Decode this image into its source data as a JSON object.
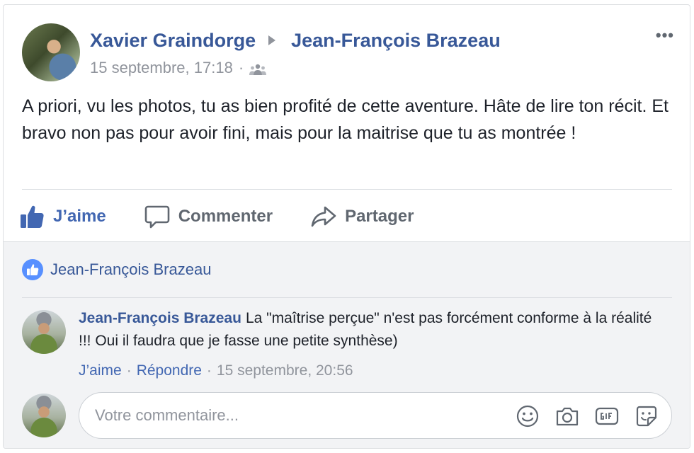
{
  "post": {
    "author": "Xavier Graindorge",
    "recipient": "Jean-François Brazeau",
    "timestamp": "15 septembre, 17:18",
    "meta_separator": "·",
    "audience_icon": "group-icon",
    "more_label": "•••",
    "text": "A priori, vu les photos, tu as bien profité de cette aventure. Hâte de lire ton récit. Et bravo non pas pour avoir fini, mais pour la maitrise que tu as montrée !"
  },
  "actions": {
    "like_label": "J’aime",
    "comment_label": "Commenter",
    "share_label": "Partager"
  },
  "reactions": {
    "liker": "Jean-François Brazeau"
  },
  "comment": {
    "author": "Jean-François Brazeau",
    "text": "La \"maîtrise perçue\" n'est pas forcément conforme à la réalité !!! Oui il faudra que je fasse une petite synthèse)",
    "like_label": "J’aime",
    "reply_label": "Répondre",
    "separator": "·",
    "timestamp": "15 septembre, 20:56"
  },
  "reply_box": {
    "placeholder": "Votre commentaire..."
  },
  "colors": {
    "brand_link": "#385898",
    "action_blue": "#4267b2",
    "muted": "#90949c",
    "comments_bg": "#f2f3f5"
  }
}
